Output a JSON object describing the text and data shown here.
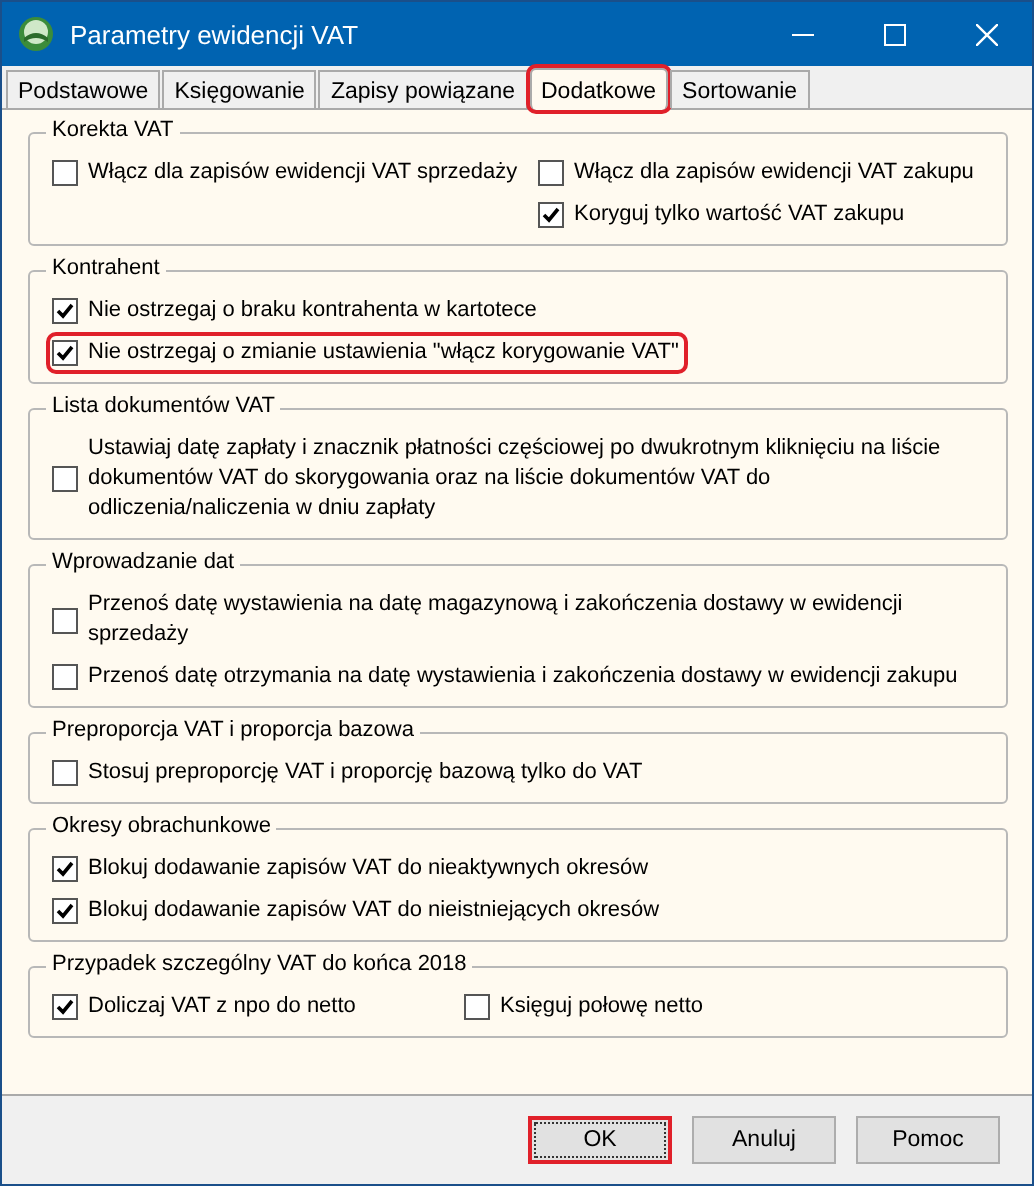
{
  "window": {
    "title": "Parametry ewidencji VAT"
  },
  "tabs": [
    {
      "label": "Podstawowe",
      "selected": false,
      "highlighted": false
    },
    {
      "label": "Księgowanie",
      "selected": false,
      "highlighted": false
    },
    {
      "label": "Zapisy powiązane",
      "selected": false,
      "highlighted": false
    },
    {
      "label": "Dodatkowe",
      "selected": true,
      "highlighted": true
    },
    {
      "label": "Sortowanie",
      "selected": false,
      "highlighted": false
    }
  ],
  "groups": [
    {
      "title": "Korekta VAT",
      "kind": "two-column",
      "left": [
        {
          "label": "Włącz dla zapisów ewidencji VAT sprzedaży",
          "checked": false,
          "highlighted": false
        }
      ],
      "right": [
        {
          "label": "Włącz dla zapisów ewidencji VAT zakupu",
          "checked": false,
          "highlighted": false
        },
        {
          "label": "Koryguj tylko wartość VAT zakupu",
          "checked": true,
          "highlighted": false
        }
      ]
    },
    {
      "title": "Kontrahent",
      "kind": "single",
      "options": [
        {
          "label": "Nie ostrzegaj o braku kontrahenta w kartotece",
          "checked": true,
          "highlighted": false
        },
        {
          "label": "Nie ostrzegaj o zmianie ustawienia \"włącz korygowanie VAT\"",
          "checked": true,
          "highlighted": true
        }
      ]
    },
    {
      "title": "Lista dokumentów VAT",
      "kind": "single",
      "options": [
        {
          "label": "Ustawiaj datę zapłaty i znacznik płatności częściowej po dwukrotnym kliknięciu na liście dokumentów VAT do skorygowania oraz na liście dokumentów VAT do odliczenia/naliczenia w dniu zapłaty",
          "checked": false,
          "highlighted": false
        }
      ]
    },
    {
      "title": "Wprowadzanie dat",
      "kind": "single",
      "options": [
        {
          "label": "Przenoś datę wystawienia na datę magazynową i zakończenia dostawy w ewidencji sprzedaży",
          "checked": false,
          "highlighted": false
        },
        {
          "label": "Przenoś datę otrzymania na datę wystawienia i zakończenia dostawy w ewidencji zakupu",
          "checked": false,
          "highlighted": false
        }
      ]
    },
    {
      "title": "Preproporcja VAT i proporcja bazowa",
      "kind": "single",
      "options": [
        {
          "label": "Stosuj preproporcję VAT i proporcję bazową tylko do VAT",
          "checked": false,
          "highlighted": false
        }
      ]
    },
    {
      "title": "Okresy obrachunkowe",
      "kind": "single",
      "options": [
        {
          "label": "Blokuj dodawanie zapisów VAT do nieaktywnych okresów",
          "checked": true,
          "highlighted": false
        },
        {
          "label": "Blokuj dodawanie zapisów VAT do nieistniejących okresów",
          "checked": true,
          "highlighted": false
        }
      ]
    },
    {
      "title": "Przypadek szczególny VAT do końca 2018",
      "kind": "two-column",
      "left": [
        {
          "label": "Doliczaj VAT z npo do netto",
          "checked": true,
          "highlighted": false
        }
      ],
      "right": [
        {
          "label": "Księguj połowę netto",
          "checked": false,
          "highlighted": false
        }
      ]
    }
  ],
  "buttons": [
    {
      "label": "OK",
      "default": true,
      "highlighted": true
    },
    {
      "label": "Anuluj",
      "default": false,
      "highlighted": false
    },
    {
      "label": "Pomoc",
      "default": false,
      "highlighted": false
    }
  ]
}
